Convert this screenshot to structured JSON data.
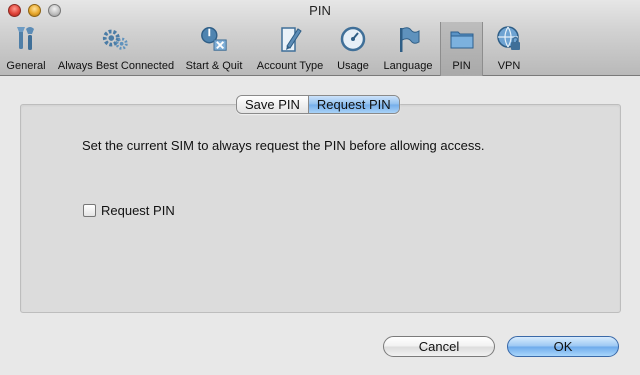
{
  "window": {
    "title": "PIN"
  },
  "toolbar": {
    "items": [
      {
        "label": "General",
        "icon": "tools-icon"
      },
      {
        "label": "Always Best Connected",
        "icon": "gears-icon"
      },
      {
        "label": "Start & Quit",
        "icon": "start-quit-icon"
      },
      {
        "label": "Account Type",
        "icon": "pen-document-icon"
      },
      {
        "label": "Usage",
        "icon": "gauge-icon"
      },
      {
        "label": "Language",
        "icon": "flag-icon"
      },
      {
        "label": "PIN",
        "icon": "sim-card-icon",
        "selected": true
      },
      {
        "label": "VPN",
        "icon": "globe-lock-icon"
      }
    ]
  },
  "tabs": {
    "save_pin": "Save PIN",
    "request_pin": "Request PIN",
    "active": "Request PIN"
  },
  "content": {
    "description": "Set the current SIM to always request the PIN before allowing access.",
    "checkbox_label": "Request PIN",
    "checkbox_checked": false
  },
  "buttons": {
    "cancel": "Cancel",
    "ok": "OK"
  },
  "colors": {
    "accent_blue": "#74adea",
    "window_bg": "#e8e8e8"
  }
}
